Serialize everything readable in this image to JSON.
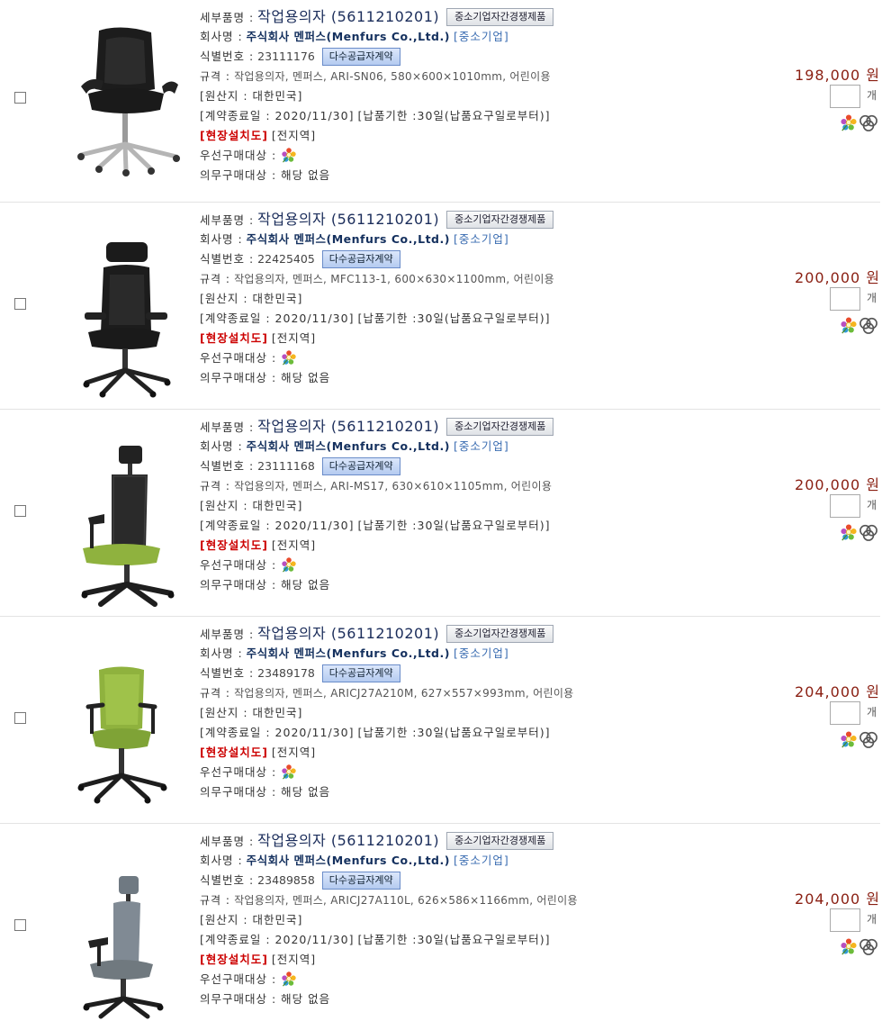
{
  "labels": {
    "detail_name": "세부품명 :",
    "company": "회사명 :",
    "id": "식별번호 :",
    "spec": "규격 :",
    "origin": "[원산지 : 대한민국]",
    "contract": "[계약종료일 : 2020/11/30]",
    "delivery": "[납품기한 :30일(납품요구일로부터)]",
    "install": "[현장설치도]",
    "region": "[전지역]",
    "priority": "우선구매대상 :",
    "mandatory": "의무구매대상 : 해당 없음",
    "unit": "개",
    "sme": "[중소기업]",
    "company_name": "주식회사 멘퍼스(Menfurs Co.,Ltd.)",
    "badge_competition": "중소기업자간경쟁제품",
    "badge_multi": "다수공급자계약"
  },
  "icons": {
    "priority": "green-flower-icon",
    "cert": "certification-rings-icon"
  },
  "colors": {
    "price": "#8a1f12",
    "install_red": "#cc0000",
    "sme_blue": "#3a6cb1",
    "chair_black": "#1c1c1c",
    "seat_lime": "#8fb23e",
    "upholstery_gray": "#808a94"
  },
  "products": [
    {
      "title": "작업용의자 (5611210201)",
      "id": "23111176",
      "spec": "작업용의자, 멘퍼스, ARI-SN06, 580×600×1010mm, 어린이용",
      "price": "198,000 원",
      "image": "black-leather-executive-chair"
    },
    {
      "title": "작업용의자 (5611210201)",
      "id": "22425405",
      "spec": "작업용의자, 멘퍼스, MFC113-1, 600×630×1100mm, 어린이용",
      "price": "200,000 원",
      "image": "black-high-back-headrest-chair"
    },
    {
      "title": "작업용의자 (5611210201)",
      "id": "23111168",
      "spec": "작업용의자, 멘퍼스, ARI-MS17, 630×610×1105mm, 어린이용",
      "price": "200,000 원",
      "image": "black-mesh-green-seat-chair"
    },
    {
      "title": "작업용의자 (5611210201)",
      "id": "23489178",
      "spec": "작업용의자, 멘퍼스, ARICJ27A210M, 627×557×993mm, 어린이용",
      "price": "204,000 원",
      "image": "lime-green-task-chair"
    },
    {
      "title": "작업용의자 (5611210201)",
      "id": "23489858",
      "spec": "작업용의자, 멘퍼스, ARICJ27A110L, 626×586×1166mm, 어린이용",
      "price": "204,000 원",
      "image": "gray-headrest-task-chair"
    }
  ]
}
